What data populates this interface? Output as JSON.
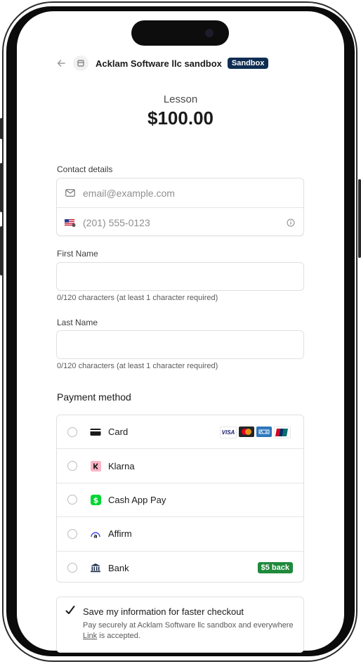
{
  "header": {
    "merchant_name": "Acklam Software llc sandbox",
    "badge": "Sandbox"
  },
  "product": {
    "name": "Lesson",
    "price": "$100.00"
  },
  "contact": {
    "label": "Contact details",
    "email_placeholder": "email@example.com",
    "phone_placeholder": "(201) 555-0123"
  },
  "first_name": {
    "label": "First Name",
    "value": "",
    "helper": "0/120 characters (at least 1 character required)"
  },
  "last_name": {
    "label": "Last Name",
    "value": "",
    "helper": "0/120 characters (at least 1 character required)"
  },
  "payment": {
    "title": "Payment method",
    "methods": [
      {
        "label": "Card",
        "icon": "card-icon"
      },
      {
        "label": "Klarna",
        "icon": "klarna-icon"
      },
      {
        "label": "Cash App Pay",
        "icon": "cashapp-icon"
      },
      {
        "label": "Affirm",
        "icon": "affirm-icon"
      },
      {
        "label": "Bank",
        "icon": "bank-icon"
      }
    ],
    "card_brands": [
      "VISA"
    ],
    "bank_badge": "$5 back"
  },
  "save_info": {
    "checked": true,
    "title": "Save my information for faster checkout",
    "desc_before": "Pay securely at Acklam Software llc sandbox and everywhere ",
    "link_word": "Link",
    "desc_after": " is accepted."
  },
  "colors": {
    "badge_bg": "#0f2d52",
    "cashback_bg": "#1f8a3b",
    "klarna_pink": "#ffb3c7",
    "cashapp_green": "#00d632"
  }
}
